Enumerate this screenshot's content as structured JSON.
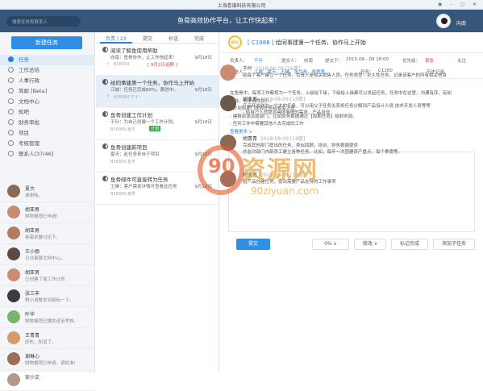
{
  "window": {
    "title": "上海卷谱科技有限公司",
    "controls": "◉ – ◻ ✕"
  },
  "topbar": {
    "search_placeholder": "搜索任务和联系人",
    "slogan": "鱼骨高效协作平台，让工作快起来！",
    "user": "向南"
  },
  "sidebar": {
    "new_task": "新建任务",
    "menu": [
      {
        "label": "任务",
        "active": true
      },
      {
        "label": "工作总结"
      },
      {
        "label": "人事行政"
      },
      {
        "label": "简邮 [Beta]"
      },
      {
        "label": "文档中心"
      },
      {
        "label": "知吧"
      },
      {
        "label": "财务审批"
      },
      {
        "label": "项目"
      },
      {
        "label": "考核管理"
      },
      {
        "label": "联系人[37/46]"
      }
    ],
    "contacts": [
      {
        "name": "夏大",
        "msg": "谢谢啦。",
        "color": "#8a6a52"
      },
      {
        "name": "胡亚男",
        "msg": "财物报销已申请!",
        "color": "#c98c73"
      },
      {
        "name": "胡亚男",
        "msg": "新需求要讨论下。",
        "color": "#b67a63"
      },
      {
        "name": "王小丽",
        "msg": "日共事算文档中心。",
        "color": "#5b4a44"
      },
      {
        "name": "胡亚男",
        "msg": "已创建了周工作计划",
        "color": "#c98c73"
      },
      {
        "name": "张三丰",
        "msg": "稍小调整发到鼠标一下。",
        "color": "#3c3c3c"
      },
      {
        "name": "叶华",
        "msg": "财物报销已播发送至考核。",
        "color": "#7ab36d"
      },
      {
        "name": "王青青",
        "msg": "好的，知道了。",
        "color": "#d79a6a"
      },
      {
        "name": "谢琳心",
        "msg": "财物报销已申请，请批准!",
        "color": "#9b6b5c"
      },
      {
        "name": "安小文",
        "msg": "",
        "color": "#b49986"
      }
    ]
  },
  "tasklist": {
    "tabs": [
      "负责 | 23",
      "提交",
      "抄送",
      "完成"
    ],
    "items": [
      {
        "title": "阅读了鲸鱼使用帮助",
        "desc": "向南：鱼骨协作，让工作快起来！",
        "date": "9月18日",
        "id": "B38999",
        "late": "[ 9月2日逾期 ]",
        "warn": true
      },
      {
        "title": "给同事建第一个任务，协作马上开始",
        "desc": "江城：任务已完成80%，跟进中。",
        "date": "9月18日",
        "id": "B38989 不十",
        "selected": true,
        "warn": true
      },
      {
        "title": "鱼骨创建工作计划",
        "desc": "于针：为自己创建一个工作计划。",
        "date": "9月18日",
        "id": "B38989 夏天",
        "tag": "计划"
      },
      {
        "title": "鱼骨创建新项目",
        "desc": "夏天：此任务来自于项目",
        "date": "9月18日",
        "id": "B38989 夏天"
      },
      {
        "title": "鱼骨邮件可直接转为任务",
        "desc": "王琳：客户需求详情可查看此任务",
        "date": "9月18日",
        "id": "B38989 秦秀"
      }
    ]
  },
  "detail": {
    "badge": "80%",
    "code": "[ C1988 ]",
    "title": "给同事建第一个任务，协作马上开始",
    "owner_label": "负责人：",
    "owner": "千叶",
    "submitter_label": "提交人：",
    "submitter": "向南",
    "time_label": "提交于：",
    "time": "2015-08 - 09 18:00",
    "priority_label": "优先级：",
    "priority": "紧急",
    "follow": "关注",
    "cc_label": "抄送人：",
    "cc": "江城，夏天，王琳，张文青，李思思",
    "project_label": "任务：",
    "project": "C1280",
    "history": "历史记录",
    "desc_lines": [
      "在鱼骨中，每项工作都视为一个任务，上级给下级，下级给上级都可以发起任务，任务中在这里，沟通有序，有如",
      "有线，效率自然提升。",
      "- 分到别部门轮转任务给相关人员",
      "- 建群资源派给部门，比如财务数据通过【周期任务】给财务部。",
      "- 任何工作中需要其他人去完成的工作"
    ],
    "more": "查看更多 ∨",
    "submit": "提交",
    "progress": "0%  ∨",
    "edit": "修改  ∨",
    "mark_done": "标记完成",
    "add_sub": "添加子任务"
  },
  "comments": [
    {
      "name": "千叶",
      "time": "2018-08-09 [16楼]",
      "text": "给每个客户建立一个任务，负责人是相关销售人员。任务类型 - 永久性任务，记录该客户的所有相关信息",
      "color": "#c98c73"
    },
    {
      "name": "胡亚男",
      "time": "2018-08-09 [15楼]",
      "text": "产品开发作为一个大的任务，可以用父子任务关系将任务分解到产品设计人员,技术开发人员等等\n- 给自己人员提派具体事情的需求，产品设设",
      "color": "#6b5a4c"
    },
    {
      "name": "胡青青",
      "time": "2018-08-09 [14楼]",
      "text": "完成其他部门提出的任务，类似回顾，培训，财务数据提供\n总监对部门内部员工建立各种任务，比如，每年一次团建资产盘点，每个季度等。",
      "color": "#8a6a52"
    },
    {
      "name": "胡亚男",
      "time": "2018-08-09 [13楼]",
      "text": "给产品创建任务，提出需要产品支持的工作事项",
      "color": "#a86e58"
    }
  ],
  "watermark": {
    "cn": "资源网",
    "url": "90ziyuan.com"
  }
}
